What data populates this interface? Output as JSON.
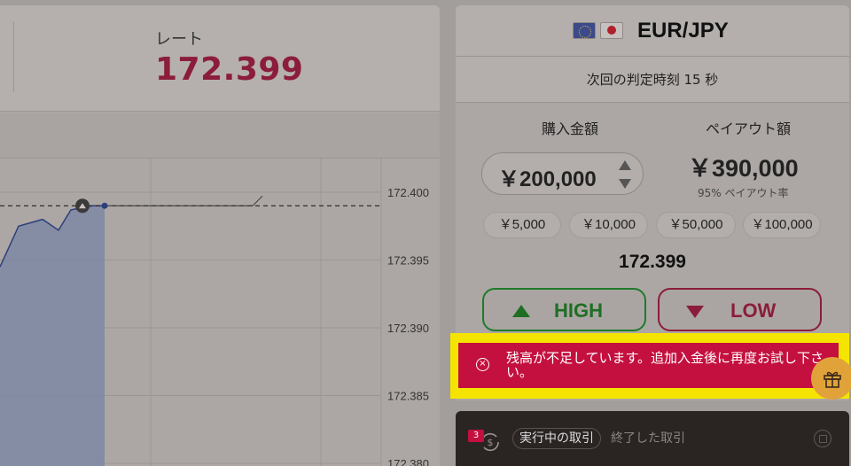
{
  "rate_panel": {
    "label": "レート",
    "value": "172.399"
  },
  "chart": {
    "y_ticks": [
      "172.400",
      "172.395",
      "172.390",
      "172.385",
      "172.380"
    ]
  },
  "chart_data": {
    "type": "line",
    "ylim": [
      172.38,
      172.401
    ],
    "yticks": [
      172.4,
      172.395,
      172.39,
      172.385,
      172.38
    ],
    "series": [
      {
        "values": [
          172.3945,
          172.3975,
          172.398,
          172.3972,
          172.3987,
          172.399,
          172.399
        ]
      }
    ],
    "reference_line": 172.399,
    "xlabel": "",
    "ylabel": ""
  },
  "trade": {
    "pair": "EUR/JPY",
    "expiry_text": "次回の判定時刻 15 秒",
    "amount_label": "購入金額",
    "payout_label": "ペイアウト額",
    "amount_value": "￥200,000",
    "payout_value": "￥390,000",
    "payout_rate": "95% ペイアウト率",
    "quick_amounts": [
      "￥5,000",
      "￥10,000",
      "￥50,000",
      "￥100,000"
    ],
    "current_rate": "172.399",
    "high_label": "HIGH",
    "low_label": "LOW"
  },
  "alert": {
    "message": "残高が不足しています。追加入金後に再度お試し下さい。"
  },
  "trades_bar": {
    "count": "3",
    "tab_active": "実行中の取引",
    "tab_inactive": "終了した取引"
  },
  "colors": {
    "rate_accent": "#8b1d3a",
    "high": "#1f7a2a",
    "low": "#8b1d3a",
    "alert_bg": "#c4103f",
    "highlight": "#f5e400",
    "gift": "#e2a23a"
  },
  "icons": {
    "up": "triangle-up-icon",
    "down": "triangle-down-icon",
    "alert": "error-circle-icon",
    "gift": "gift-icon",
    "trades": "exchange-icon",
    "external": "external-link-icon"
  }
}
